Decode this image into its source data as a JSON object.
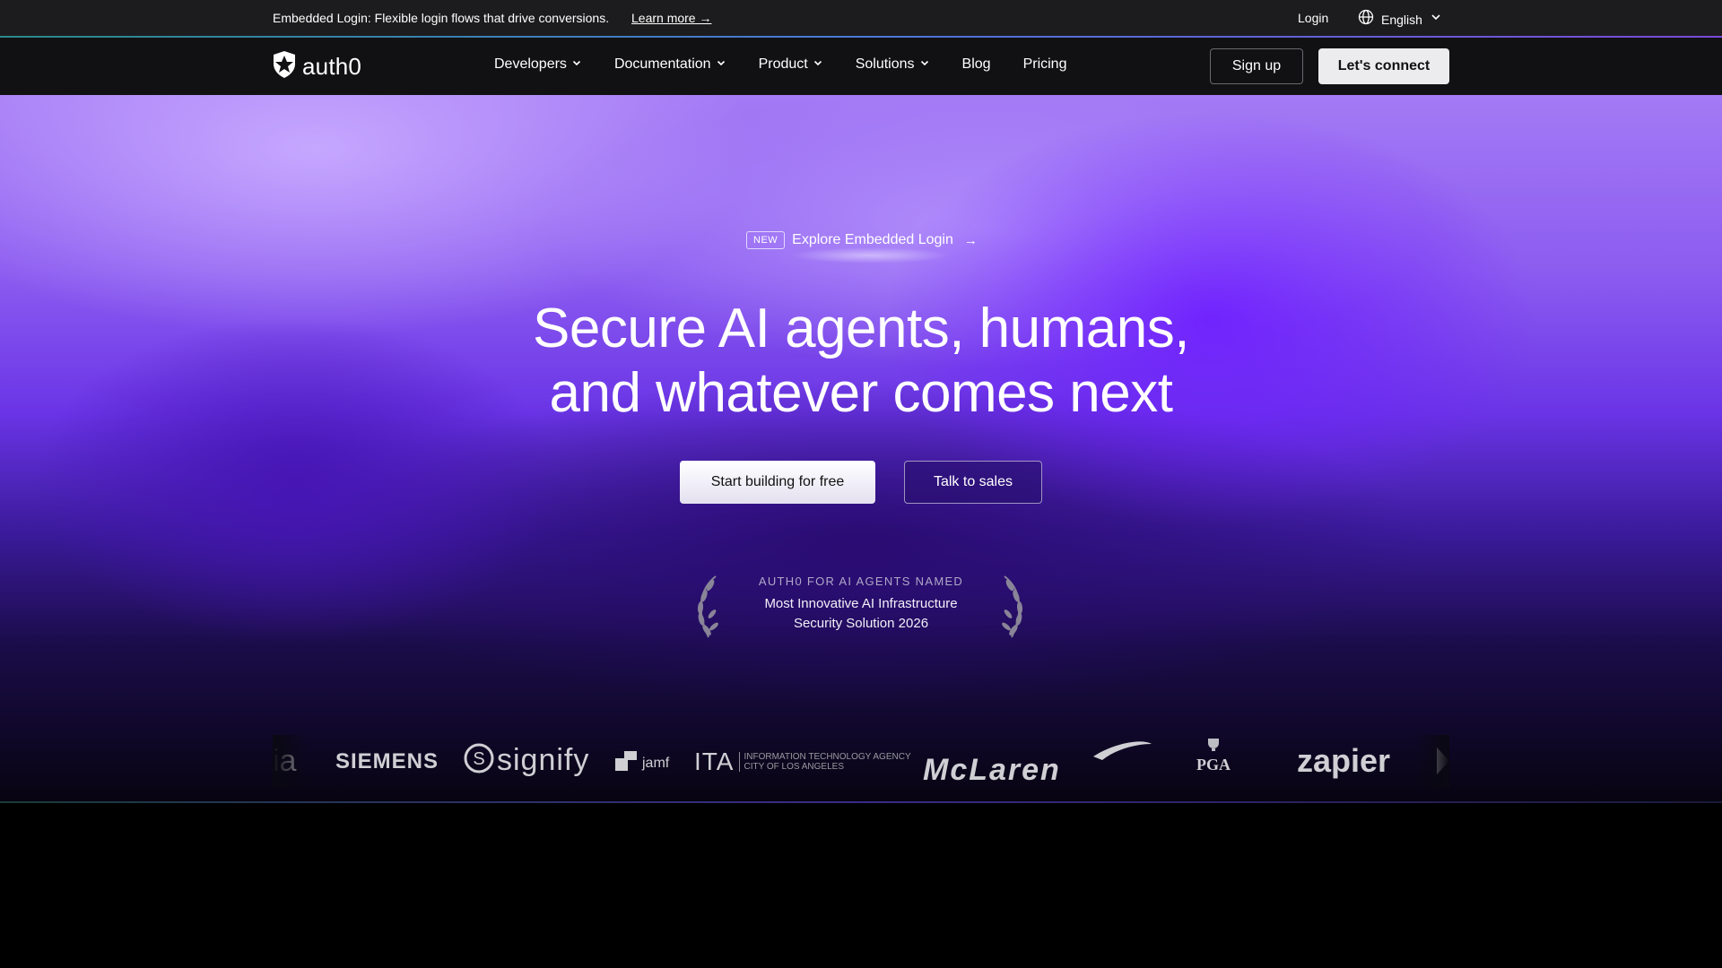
{
  "announcement": {
    "message": "Embedded Login: Flexible login flows that drive conversions.",
    "learn_more": "Learn more →",
    "login": "Login",
    "language": "English"
  },
  "nav": {
    "brand": "auth0",
    "items": [
      {
        "label": "Developers",
        "has_dropdown": true
      },
      {
        "label": "Documentation",
        "has_dropdown": true
      },
      {
        "label": "Product",
        "has_dropdown": true
      },
      {
        "label": "Solutions",
        "has_dropdown": true
      },
      {
        "label": "Blog",
        "has_dropdown": false
      },
      {
        "label": "Pricing",
        "has_dropdown": false
      }
    ],
    "signup": "Sign up",
    "connect": "Let's connect"
  },
  "hero": {
    "badge": "NEW",
    "pill_text": "Explore Embedded Login",
    "pill_arrow": "→",
    "headline_line1": "Secure AI agents, humans,",
    "headline_line2": "and whatever comes next",
    "cta_primary": "Start building for free",
    "cta_secondary": "Talk to sales",
    "award_kicker": "AUTH0 FOR AI AGENTS NAMED",
    "award_line1": "Most Innovative AI Infrastructure",
    "award_line2": "Security Solution 2026"
  },
  "logos": {
    "items": [
      "ia",
      "SIEMENS",
      "signify",
      "jamf",
      "ITA",
      "INFORMATION TECHNOLOGY AGENCY",
      "CITY OF LOS ANGELES",
      "McLaren",
      "PGA",
      "zapier"
    ]
  },
  "colors": {
    "announcement_bg": "#1c1c1e",
    "nav_bg": "#111113",
    "hero_purple": "#6a34e6",
    "button_light": "#ececef"
  }
}
